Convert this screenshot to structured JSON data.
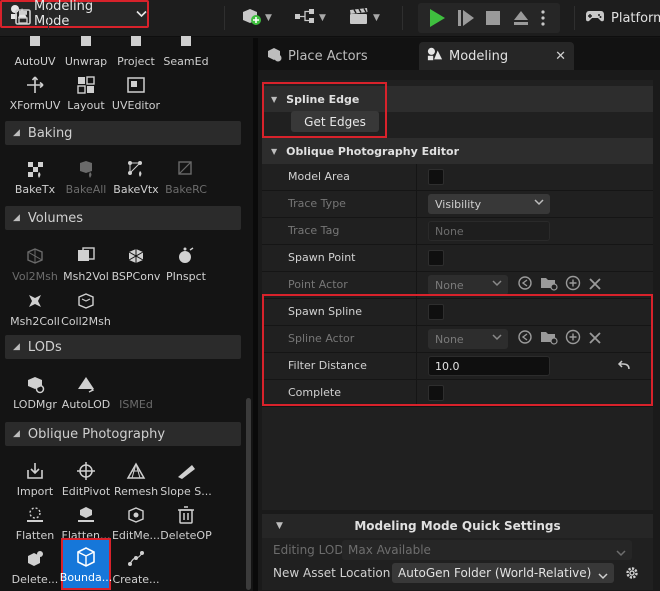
{
  "toolbar": {
    "save_icon": "save-icon",
    "mode_label": "Modeling Mode",
    "platforms_label": "Platform"
  },
  "left_panel": {
    "top_row_labels": [
      "AutoUV",
      "Unwrap",
      "Project",
      "SeamEd"
    ],
    "uv_tools": [
      {
        "label": "XFormUV",
        "icon": "xform-uv-icon"
      },
      {
        "label": "Layout",
        "icon": "layout-icon"
      },
      {
        "label": "UVEditor",
        "icon": "uv-editor-icon"
      }
    ],
    "sections": {
      "baking": {
        "title": "Baking",
        "tools": [
          {
            "label": "BakeTx",
            "icon": "bake-tx-icon",
            "enabled": true
          },
          {
            "label": "BakeAll",
            "icon": "bake-all-icon",
            "enabled": false
          },
          {
            "label": "BakeVtx",
            "icon": "bake-vtx-icon",
            "enabled": true
          },
          {
            "label": "BakeRC",
            "icon": "bake-rc-icon",
            "enabled": false
          }
        ]
      },
      "volumes": {
        "title": "Volumes",
        "tools": [
          {
            "label": "Vol2Msh",
            "icon": "vol2msh-icon",
            "enabled": false
          },
          {
            "label": "Msh2Vol",
            "icon": "msh2vol-icon",
            "enabled": true
          },
          {
            "label": "BSPConv",
            "icon": "bspconv-icon",
            "enabled": true
          },
          {
            "label": "PInspct",
            "icon": "pinspect-icon",
            "enabled": true
          },
          {
            "label": "Msh2Coll",
            "icon": "msh2coll-icon",
            "enabled": true
          },
          {
            "label": "Coll2Msh",
            "icon": "coll2msh-icon",
            "enabled": true
          }
        ]
      },
      "lods": {
        "title": "LODs",
        "tools": [
          {
            "label": "LODMgr",
            "icon": "lod-manager-icon",
            "enabled": true
          },
          {
            "label": "AutoLOD",
            "icon": "auto-lod-icon",
            "enabled": true
          },
          {
            "label": "ISMEd",
            "icon": "ism-editor-icon",
            "enabled": false
          }
        ]
      },
      "oblique": {
        "title": "Oblique Photography",
        "tools": [
          {
            "label": "Import",
            "icon": "import-icon",
            "enabled": true
          },
          {
            "label": "EditPivot",
            "icon": "edit-pivot-icon",
            "enabled": true
          },
          {
            "label": "Remesh",
            "icon": "remesh-icon",
            "enabled": true
          },
          {
            "label": "Slope S...",
            "icon": "slope-icon",
            "enabled": true
          },
          {
            "label": "Flatten",
            "icon": "flatten-icon",
            "enabled": true
          },
          {
            "label": "Flatten...",
            "icon": "flatten-more-icon",
            "enabled": true
          },
          {
            "label": "EditMe...",
            "icon": "edit-mesh-icon",
            "enabled": true
          },
          {
            "label": "DeleteOP",
            "icon": "delete-op-icon",
            "enabled": true
          },
          {
            "label": "Delete...",
            "icon": "delete-icon",
            "enabled": true
          },
          {
            "label": "Bounda...",
            "icon": "boundary-icon",
            "enabled": true,
            "selected": true
          },
          {
            "label": "Create...",
            "icon": "create-icon",
            "enabled": true
          }
        ]
      }
    }
  },
  "tabs": [
    {
      "label": "Place Actors",
      "icon": "place-actors-icon",
      "active": false
    },
    {
      "label": "Modeling",
      "icon": "modeling-icon",
      "active": true
    }
  ],
  "details": {
    "spline_edge": {
      "title": "Spline Edge",
      "button_label": "Get Edges"
    },
    "oblique_editor": {
      "title": "Oblique Photography Editor",
      "rows": {
        "model_area": {
          "label": "Model Area",
          "checked": false
        },
        "trace_type": {
          "label": "Trace Type",
          "value": "Visibility"
        },
        "trace_tag": {
          "label": "Trace Tag",
          "value": "None"
        },
        "spawn_point": {
          "label": "Spawn Point",
          "checked": false
        },
        "point_actor": {
          "label": "Point Actor",
          "value": "None"
        },
        "spawn_spline": {
          "label": "Spawn Spline",
          "checked": false
        },
        "spline_actor": {
          "label": "Spline Actor",
          "value": "None"
        },
        "filter_distance": {
          "label": "Filter Distance",
          "value": "10.0"
        },
        "complete": {
          "label": "Complete",
          "checked": false
        }
      }
    }
  },
  "quick_settings": {
    "title": "Modeling Mode Quick Settings",
    "editing_lod_label": "Editing LOD",
    "editing_lod_value": "Max Available",
    "new_asset_location_label": "New Asset Location",
    "new_asset_location_value": "AutoGen Folder (World-Relative)"
  },
  "colors": {
    "highlight_red": "#d8222b",
    "selected_blue": "#1677d9",
    "play_green": "#3fbf3f"
  }
}
